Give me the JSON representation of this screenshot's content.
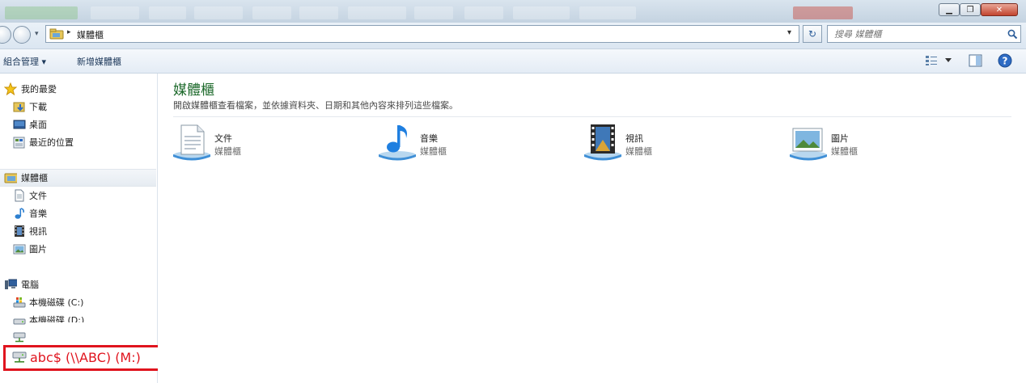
{
  "window": {
    "minimize_glyph": "▁",
    "maximize_glyph": "❐",
    "close_glyph": "✕"
  },
  "address": {
    "breadcrumb_sep": "▸",
    "path": "媒體櫃",
    "dropdown_glyph": "▾",
    "refresh_glyph": "↻",
    "search_placeholder": "搜尋 媒體櫃",
    "search_icon": "magnifier-icon"
  },
  "commands": {
    "organize": "組合管理 ▾",
    "new_library": "新增媒體櫃"
  },
  "sidebar": {
    "favorites": {
      "header": "我的最愛",
      "items": [
        "下載",
        "桌面",
        "最近的位置"
      ]
    },
    "libraries": {
      "header": "媒體櫃",
      "items": [
        "文件",
        "音樂",
        "視訊",
        "圖片"
      ]
    },
    "computer": {
      "header": "電腦",
      "items": [
        "本機磁碟 (C:)",
        "本機磁碟 (D:)"
      ]
    },
    "highlighted_drive": "abc$ (\\\\ABC) (M:)"
  },
  "main": {
    "title": "媒體櫃",
    "description": "開啟媒體櫃查看檔案，並依據資料夾、日期和其他內容來排列這些檔案。",
    "libraries": [
      {
        "name": "文件",
        "type": "媒體櫃",
        "icon": "documents-library-icon"
      },
      {
        "name": "音樂",
        "type": "媒體櫃",
        "icon": "music-library-icon"
      },
      {
        "name": "視訊",
        "type": "媒體櫃",
        "icon": "videos-library-icon"
      },
      {
        "name": "圖片",
        "type": "媒體櫃",
        "icon": "pictures-library-icon"
      }
    ]
  },
  "colors": {
    "title_green": "#1e6a2c",
    "highlight_red": "#e0141e",
    "library_blue": "#3f8fd6"
  }
}
